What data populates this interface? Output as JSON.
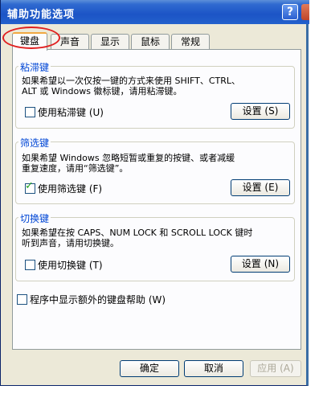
{
  "window": {
    "title": "辅助功能选项",
    "help_glyph": "?"
  },
  "tabs": [
    {
      "label": "键盘",
      "active": true
    },
    {
      "label": "声音",
      "active": false
    },
    {
      "label": "显示",
      "active": false
    },
    {
      "label": "鼠标",
      "active": false
    },
    {
      "label": "常规",
      "active": false
    }
  ],
  "sticky": {
    "title": "粘滞键",
    "desc_line1": "如果希望以一次仅按一键的方式来使用 SHIFT、CTRL、",
    "desc_line2": "ALT 或 Windows 徽标键，请用粘滞键。",
    "checkbox_label": "使用粘滞键 (U)",
    "checked": false,
    "settings_label": "设置 (S)"
  },
  "filter": {
    "title": "筛选键",
    "desc_line1": "如果希望 Windows 忽略短暂或重复的按键、或者减缓",
    "desc_line2": "重复速度，请用“筛选键”。",
    "checkbox_label": "使用筛选键 (F)",
    "checked": true,
    "settings_label": "设置 (E)"
  },
  "toggle": {
    "title": "切换键",
    "desc_line1": "如果希望在按 CAPS、NUM LOCK 和 SCROLL LOCK 键时",
    "desc_line2": "听到声音，请用切换键。",
    "checkbox_label": "使用切换键 (T)",
    "checked": false,
    "settings_label": "设置 (N)"
  },
  "extra_help": {
    "label": "程序中显示额外的键盘帮助 (W)",
    "checked": false
  },
  "footer": {
    "ok_label": "确定",
    "cancel_label": "取消",
    "apply_label": "应用 (A)"
  },
  "colors": {
    "title_bar": "#2361cc",
    "group_title": "#0046d5",
    "highlight_oval": "#e02020"
  }
}
